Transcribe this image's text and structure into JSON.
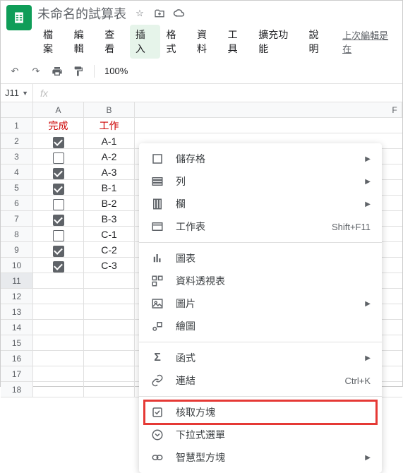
{
  "header": {
    "title": "未命名的試算表",
    "menus": [
      "檔案",
      "編輯",
      "查看",
      "插入",
      "格式",
      "資料",
      "工具",
      "擴充功能",
      "說明"
    ],
    "active_menu_index": 3,
    "last_edit": "上次編輯是在"
  },
  "toolbar": {
    "zoom": "100%"
  },
  "namebox": {
    "ref": "J11"
  },
  "columns": [
    "A",
    "B",
    "F"
  ],
  "rows": [
    {
      "n": "1",
      "a_type": "text",
      "a": "完成",
      "b": "工作",
      "hdr": true
    },
    {
      "n": "2",
      "a_type": "checkbox",
      "a_checked": true,
      "b": "A-1"
    },
    {
      "n": "3",
      "a_type": "checkbox",
      "a_checked": false,
      "b": "A-2"
    },
    {
      "n": "4",
      "a_type": "checkbox",
      "a_checked": true,
      "b": "A-3"
    },
    {
      "n": "5",
      "a_type": "checkbox",
      "a_checked": true,
      "b": "B-1"
    },
    {
      "n": "6",
      "a_type": "checkbox",
      "a_checked": false,
      "b": "B-2"
    },
    {
      "n": "7",
      "a_type": "checkbox",
      "a_checked": true,
      "b": "B-3"
    },
    {
      "n": "8",
      "a_type": "checkbox",
      "a_checked": false,
      "b": "C-1"
    },
    {
      "n": "9",
      "a_type": "checkbox",
      "a_checked": true,
      "b": "C-2"
    },
    {
      "n": "10",
      "a_type": "checkbox",
      "a_checked": true,
      "b": "C-3"
    },
    {
      "n": "11"
    },
    {
      "n": "12"
    },
    {
      "n": "13"
    },
    {
      "n": "14"
    },
    {
      "n": "15"
    },
    {
      "n": "16"
    },
    {
      "n": "17"
    },
    {
      "n": "18"
    }
  ],
  "dropdown": {
    "groups": [
      [
        {
          "icon": "cell",
          "label": "儲存格",
          "arrow": true
        },
        {
          "icon": "rows",
          "label": "列",
          "arrow": true
        },
        {
          "icon": "cols",
          "label": "欄",
          "arrow": true
        },
        {
          "icon": "sheet",
          "label": "工作表",
          "shortcut": "Shift+F11"
        }
      ],
      [
        {
          "icon": "chart",
          "label": "圖表"
        },
        {
          "icon": "pivot",
          "label": "資料透視表"
        },
        {
          "icon": "image",
          "label": "圖片",
          "arrow": true
        },
        {
          "icon": "drawing",
          "label": "繪圖"
        }
      ],
      [
        {
          "icon": "function",
          "label": "函式",
          "arrow": true
        },
        {
          "icon": "link",
          "label": "連結",
          "shortcut": "Ctrl+K"
        }
      ],
      [
        {
          "icon": "checkbox",
          "label": "核取方塊",
          "highlight": true
        },
        {
          "icon": "dropdown",
          "label": "下拉式選單"
        },
        {
          "icon": "smartchip",
          "label": "智慧型方塊",
          "arrow": true
        }
      ]
    ]
  }
}
